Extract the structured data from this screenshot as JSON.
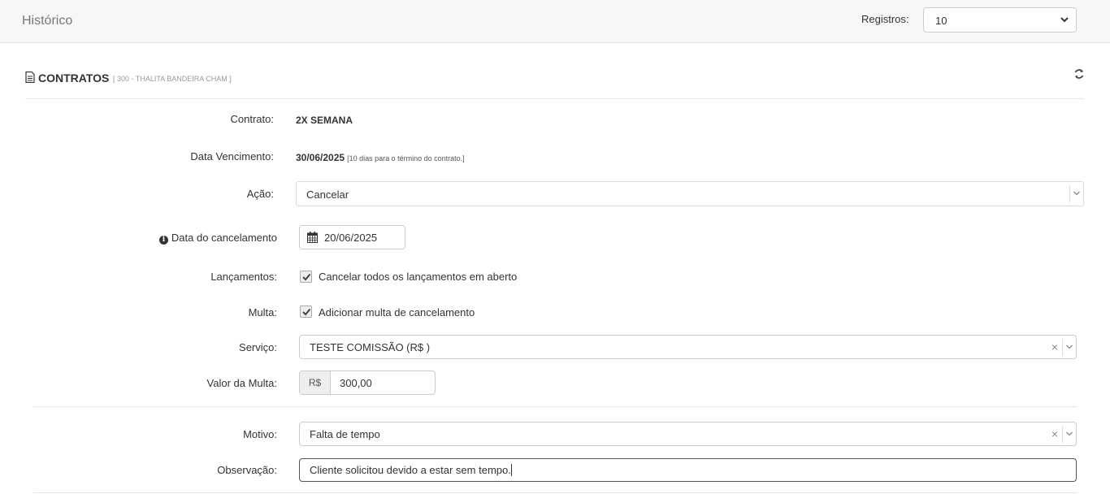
{
  "header": {
    "title": "Histórico",
    "registros_label": "Registros:",
    "registros_value": "10"
  },
  "section": {
    "title": "CONTRATOS",
    "subtitle": "[ 300 - THALITA BANDEIRA CHAM ]"
  },
  "form": {
    "contrato_label": "Contrato:",
    "contrato_value": "2X SEMANA",
    "vencimento_label": "Data Vencimento:",
    "vencimento_value": "30/06/2025",
    "vencimento_note": "[10 dias para o término do contrato.]",
    "acao_label": "Ação:",
    "acao_value": "Cancelar",
    "data_cancel_label": "Data do cancelamento",
    "data_cancel_value": "20/06/2025",
    "lancamentos_label": "Lançamentos:",
    "lancamentos_check_label": "Cancelar todos os lançamentos em aberto",
    "lancamentos_checked": true,
    "multa_label": "Multa:",
    "multa_check_label": "Adicionar multa de cancelamento",
    "multa_checked": true,
    "servico_label": "Serviço:",
    "servico_value": "TESTE COMISSÃO (R$ )",
    "valor_multa_label": "Valor da Multa:",
    "currency": "R$",
    "valor_multa_value": "300,00",
    "motivo_label": "Motivo:",
    "motivo_value": "Falta de tempo",
    "obs_label": "Observação:",
    "obs_value": "Cliente solicitou devido a estar sem tempo."
  },
  "icons": {
    "clear": "×",
    "info": "i"
  }
}
